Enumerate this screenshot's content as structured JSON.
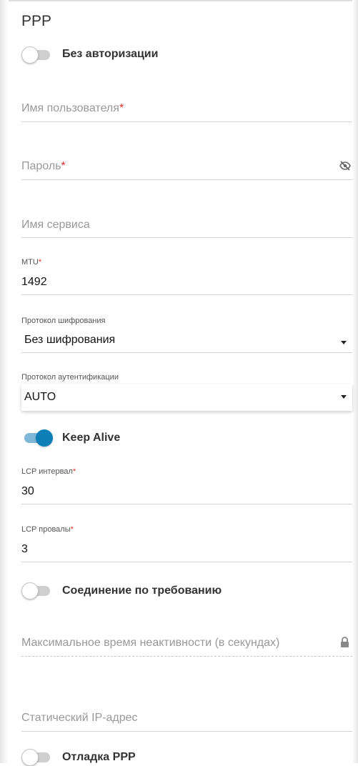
{
  "section_title": "PPP",
  "no_auth": {
    "label": "Без авторизации",
    "on": false
  },
  "username": {
    "placeholder": "Имя пользователя",
    "required_mark": "*"
  },
  "password": {
    "placeholder": "Пароль",
    "required_mark": "*",
    "icon": "eye-off-icon"
  },
  "service_name": {
    "placeholder": "Имя сервиса"
  },
  "mtu": {
    "label": "MTU",
    "required_mark": "*",
    "value": "1492"
  },
  "encryption": {
    "label": "Протокол шифрования",
    "value": "Без шифрования"
  },
  "auth_protocol": {
    "label": "Протокол аутентификации",
    "value": "AUTO"
  },
  "keep_alive": {
    "label": "Keep Alive",
    "on": true
  },
  "lcp_interval": {
    "label": "LCP интервал",
    "required_mark": "*",
    "value": "30"
  },
  "lcp_fails": {
    "label": "LCP провалы",
    "required_mark": "*",
    "value": "3"
  },
  "on_demand": {
    "label": "Соединение по требованию",
    "on": false
  },
  "max_idle": {
    "placeholder": "Максимальное время неактивности (в секундах)",
    "icon": "lock-icon"
  },
  "static_ip": {
    "placeholder": "Статический IP-адрес"
  },
  "ppp_debug": {
    "label": "Отладка PPP",
    "on": false
  },
  "colors": {
    "accent": "#0d7fb8",
    "required": "#e2302a",
    "placeholder": "#999999"
  }
}
